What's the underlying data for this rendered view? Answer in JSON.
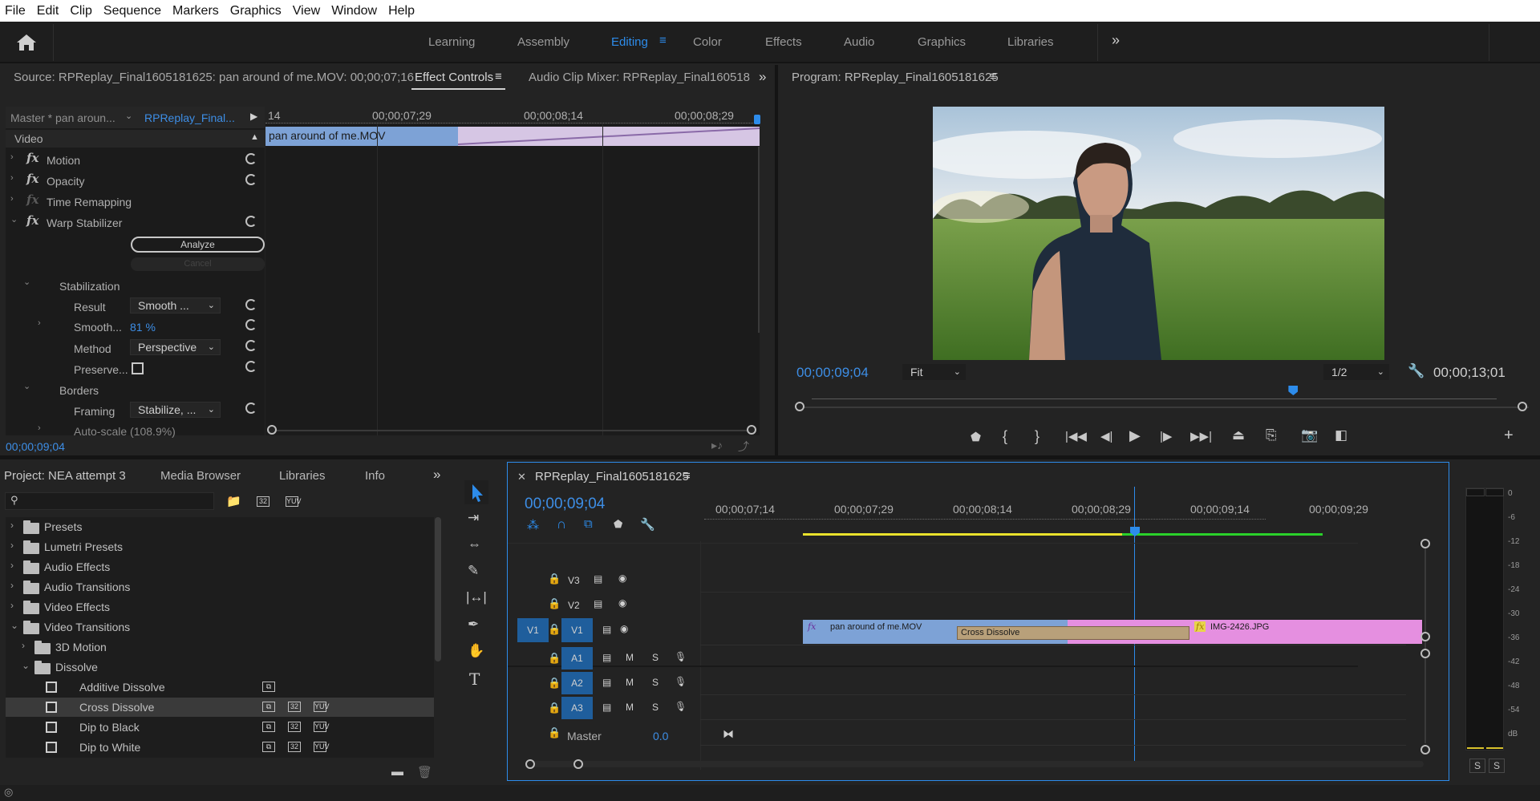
{
  "menu": [
    "File",
    "Edit",
    "Clip",
    "Sequence",
    "Markers",
    "Graphics",
    "View",
    "Window",
    "Help"
  ],
  "workspaces": {
    "tabs": [
      "Learning",
      "Assembly",
      "Editing",
      "Color",
      "Effects",
      "Audio",
      "Graphics",
      "Libraries"
    ],
    "active": "Editing",
    "overflow": "»"
  },
  "source_panel": {
    "title": "Source: RPReplay_Final1605181625: pan around of me.MOV: 00;00;07;16",
    "tab_effect_controls": "Effect Controls",
    "tab_audio_mixer": "Audio Clip Mixer: RPReplay_Final160518",
    "overflow": "»"
  },
  "effect_controls": {
    "master": "Master * pan aroun...",
    "sequence": "RPReplay_Final...",
    "ruler": [
      "14",
      "00;00;07;29",
      "00;00;08;14",
      "00;00;08;29"
    ],
    "clip_name": "pan around of me.MOV",
    "section_video": "Video",
    "effects": [
      {
        "name": "Motion",
        "fx": "fx"
      },
      {
        "name": "Opacity",
        "fx": "fx"
      },
      {
        "name": "Time Remapping",
        "fx": "fx"
      },
      {
        "name": "Warp Stabilizer",
        "fx": "fx"
      }
    ],
    "analyze": "Analyze",
    "cancel": "Cancel",
    "stabilization": "Stabilization",
    "result_label": "Result",
    "result_value": "Smooth ...",
    "smooth_label": "Smooth...",
    "smooth_value": "81 %",
    "method_label": "Method",
    "method_value": "Perspective",
    "preserve_label": "Preserve...",
    "borders": "Borders",
    "framing_label": "Framing",
    "framing_value": "Stabilize, ...",
    "autoscale": "Auto-scale (108.9%)",
    "timecode": "00;00;09;04"
  },
  "program_monitor": {
    "title": "Program: RPReplay_Final1605181625",
    "timecode": "00;00;09;04",
    "fit": "Fit",
    "resolution": "1/2",
    "duration": "00;00;13;01",
    "playhead_fraction": 0.703
  },
  "project_panel": {
    "tabs": [
      "Project: NEA attempt 3",
      "Media Browser",
      "Libraries",
      "Info"
    ],
    "overflow": "»",
    "tree": [
      {
        "label": "Presets",
        "level": 0,
        "type": "folder-star"
      },
      {
        "label": "Lumetri Presets",
        "level": 0,
        "type": "folder-star"
      },
      {
        "label": "Audio Effects",
        "level": 0,
        "type": "folder"
      },
      {
        "label": "Audio Transitions",
        "level": 0,
        "type": "folder"
      },
      {
        "label": "Video Effects",
        "level": 0,
        "type": "folder"
      },
      {
        "label": "Video Transitions",
        "level": 0,
        "type": "folder",
        "open": true
      },
      {
        "label": "3D Motion",
        "level": 1,
        "type": "folder"
      },
      {
        "label": "Dissolve",
        "level": 1,
        "type": "folder",
        "open": true
      },
      {
        "label": "Additive Dissolve",
        "level": 2,
        "type": "effect"
      },
      {
        "label": "Cross Dissolve",
        "level": 2,
        "type": "effect",
        "selected": true
      },
      {
        "label": "Dip to Black",
        "level": 2,
        "type": "effect"
      },
      {
        "label": "Dip to White",
        "level": 2,
        "type": "effect"
      }
    ]
  },
  "timeline": {
    "sequence_name": "RPReplay_Final1605181625",
    "timecode": "00;00;09;04",
    "ruler": [
      "00;00;07;14",
      "00;00;07;29",
      "00;00;08;14",
      "00;00;08;29",
      "00;00;09;14",
      "00;00;09;29"
    ],
    "video_tracks": [
      "V3",
      "V2",
      "V1"
    ],
    "source_patch": "V1",
    "audio_tracks": [
      "A1",
      "A2",
      "A3"
    ],
    "master_label": "Master",
    "master_value": "0.0",
    "clips": {
      "clip1": "pan around of me.MOV",
      "transition": "Cross Dissolve",
      "clip2": "IMG-2426.JPG"
    },
    "m_label": "M",
    "s_label": "S"
  },
  "audio_meter": {
    "scale": [
      "0",
      "-6",
      "-12",
      "-18",
      "-24",
      "-30",
      "-36",
      "-42",
      "-48",
      "-54",
      "dB"
    ],
    "solo_left": "S",
    "solo_right": "S"
  },
  "colors": {
    "accent": "#2d8ceb",
    "clip_blue": "#7da2d6",
    "clip_pink": "#e58fe0",
    "transition": "#b8a07a"
  }
}
